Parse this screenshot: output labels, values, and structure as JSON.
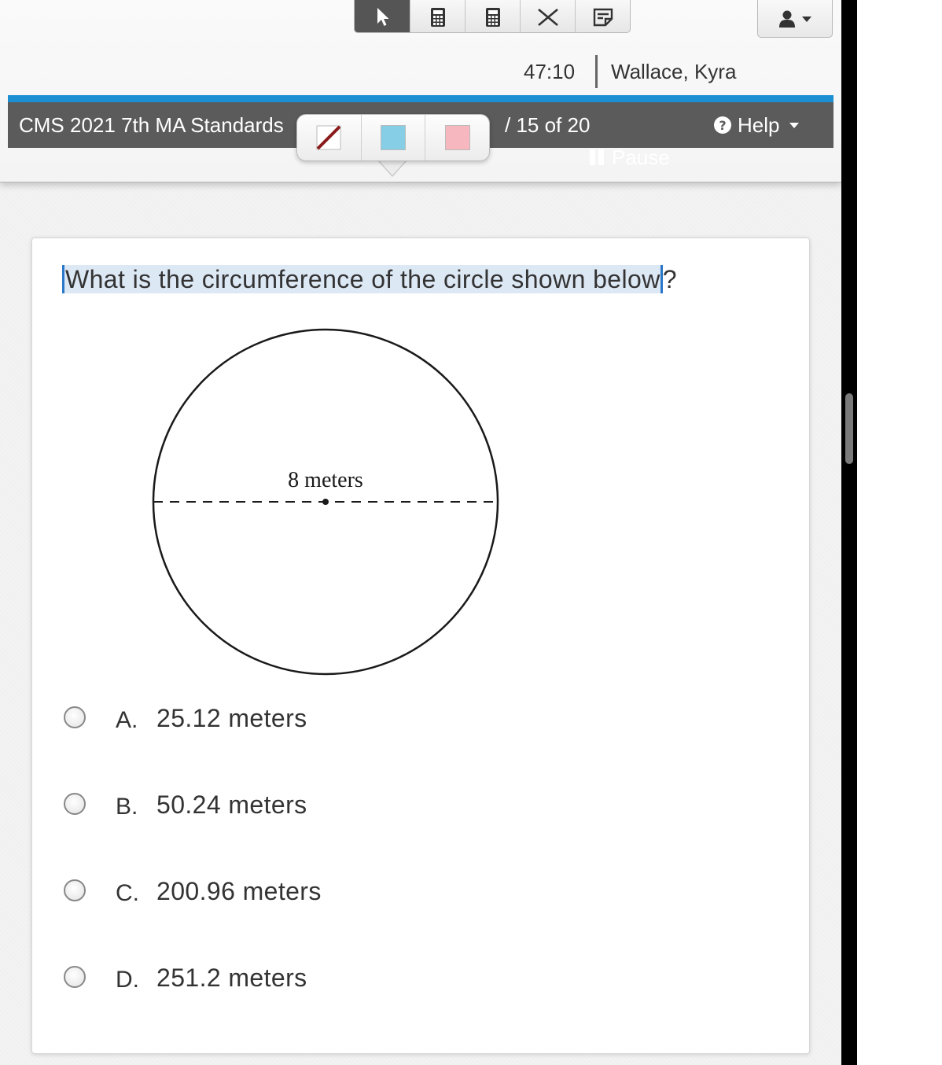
{
  "toolbar": {
    "tools": [
      {
        "icon": "pointer-icon",
        "active": true
      },
      {
        "icon": "calculator-icon",
        "active": false
      },
      {
        "icon": "calculator-icon",
        "active": false
      },
      {
        "icon": "close-icon",
        "active": false
      },
      {
        "icon": "notepad-icon",
        "active": false
      }
    ],
    "user_menu_icon": "user-icon"
  },
  "header": {
    "timer": "47:10",
    "student_name": "Wallace, Kyra",
    "test_title": "CMS 2021 7th MA Standards",
    "progress": "/  15 of 20",
    "help_label": "Help",
    "pause_label": "Pause",
    "accent_color": "#1b8fd1"
  },
  "highlighter": {
    "tools": [
      {
        "name": "eraser",
        "color": "#ffffff"
      },
      {
        "name": "blue",
        "color": "#86cde6"
      },
      {
        "name": "pink",
        "color": "#f7b7bf"
      }
    ]
  },
  "question": {
    "selected_text": "What is the circumference of the circle shown below",
    "trailing_text": "?",
    "figure_label": "8 meters"
  },
  "choices": [
    {
      "letter": "A.",
      "text": "25.12 meters"
    },
    {
      "letter": "B.",
      "text": "50.24 meters"
    },
    {
      "letter": "C.",
      "text": "200.96 meters"
    },
    {
      "letter": "D.",
      "text": "251.2 meters"
    }
  ]
}
